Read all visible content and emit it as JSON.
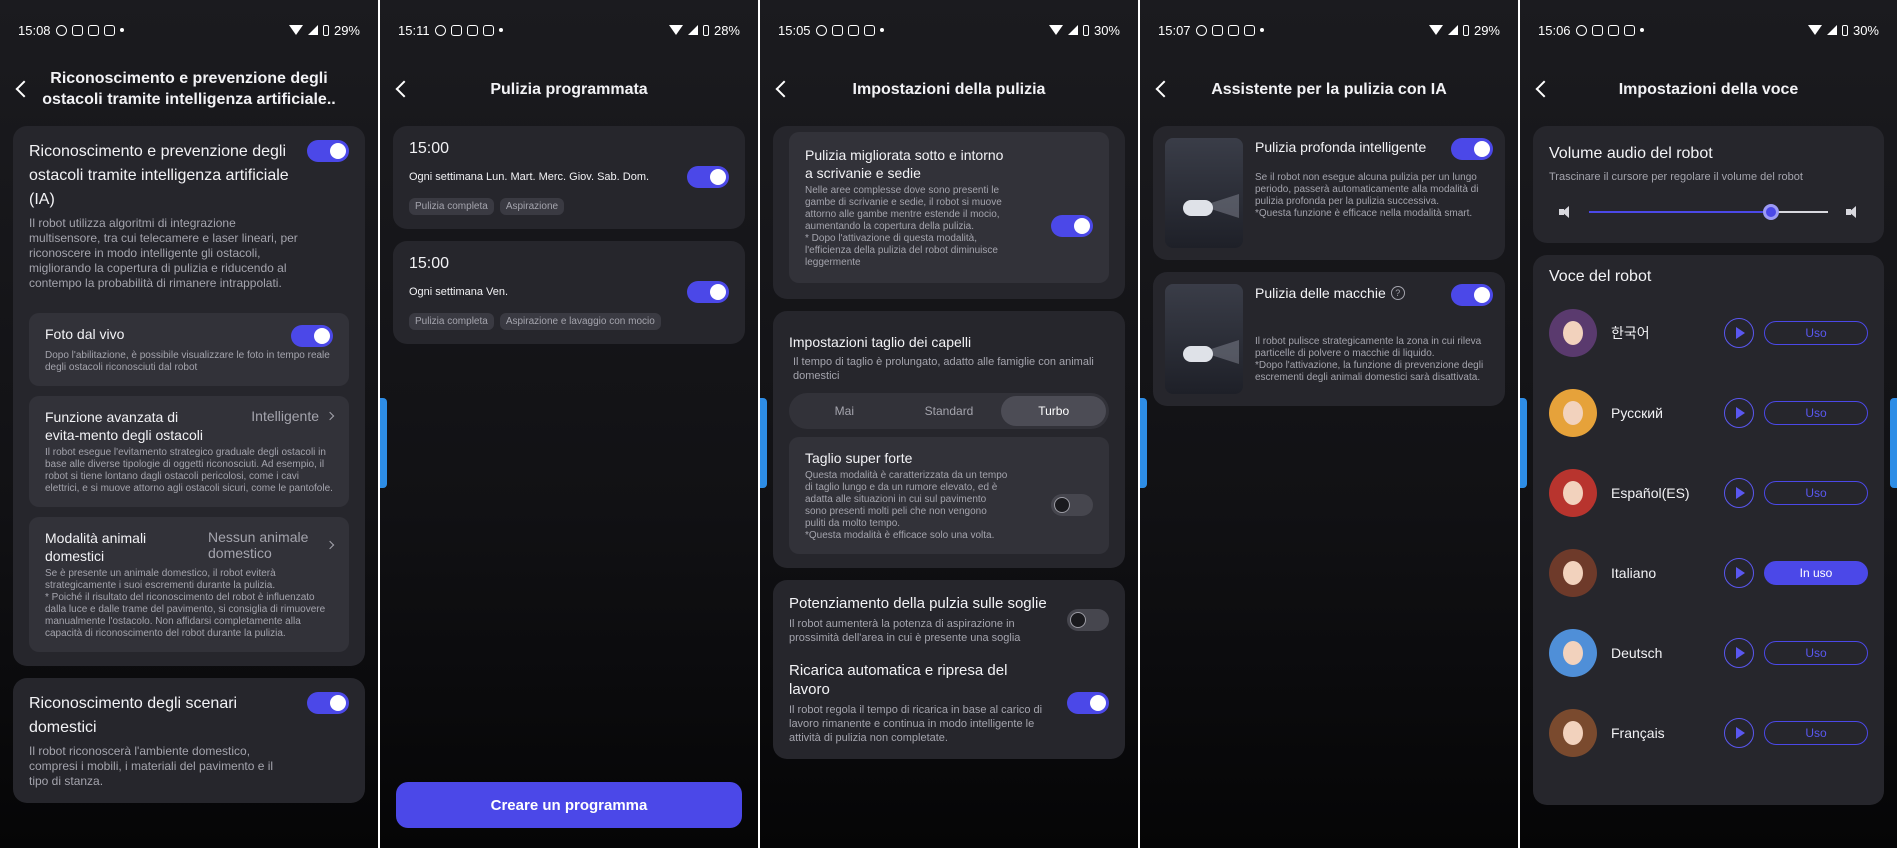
{
  "colors": {
    "accent": "#4b48e8",
    "background": "#1b1b1f",
    "card": "#26262c",
    "edge_tab": "#2d8de6"
  },
  "screens": [
    {
      "status": {
        "time": "15:08",
        "battery": "29%"
      },
      "title": "Riconoscimento e prevenzione degli ostacoli tramite intelligenza artificiale..",
      "main": {
        "title": "Riconoscimento e prevenzione degli ostacoli tramite intelligenza artificiale (IA)",
        "toggle_on": true,
        "desc": "Il robot utilizza algoritmi di integrazione multisensore, tra cui telecamere e laser lineari, per riconoscere in modo intelligente gli ostacoli, migliorando la copertura di pulizia e riducendo al contempo la probabilità di rimanere intrappolati.",
        "live_photo": {
          "title": "Foto dal vivo",
          "toggle_on": true,
          "desc": "Dopo l'abilitazione, è possibile visualizzare le foto in tempo reale degli ostacoli riconosciuti dal robot"
        },
        "advanced": {
          "title": "Funzione avanzata di evita-mento degli ostacoli",
          "value": "Intelligente",
          "desc": "Il robot esegue l'evitamento strategico graduale degli ostacoli in base alle diverse tipologie di oggetti riconosciuti. Ad esempio, il robot si tiene lontano dagli ostacoli pericolosi, come i cavi elettrici, e si muove attorno agli ostacoli sicuri, come le pantofole."
        },
        "pets": {
          "title": "Modalità animali domestici",
          "value": "Nessun animale domestico",
          "desc": "Se è presente un animale domestico, il robot eviterà strategicamente i suoi escrementi durante la pulizia.\n* Poiché il risultato del riconoscimento del robot è influenzato dalla luce e dalle trame del pavimento, si consiglia di rimuovere manualmente l'ostacolo. Non affidarsi completamente alla capacità di riconoscimento del robot durante la pulizia."
        }
      },
      "scenes": {
        "title": "Riconoscimento degli scenari domestici",
        "toggle_on": true,
        "desc": "Il robot riconoscerà l'ambiente domestico, compresi i mobili, i materiali del pavimento e il tipo di stanza."
      }
    },
    {
      "status": {
        "time": "15:11",
        "battery": "28%"
      },
      "title": "Pulizia programmata",
      "schedules": [
        {
          "time": "15:00",
          "days": "Ogni settimana Lun. Mart. Merc. Giov. Sab. Dom.",
          "toggle_on": true,
          "chips": [
            "Pulizia completa",
            "Aspirazione"
          ]
        },
        {
          "time": "15:00",
          "days": "Ogni settimana Ven.",
          "toggle_on": true,
          "chips": [
            "Pulizia completa",
            "Aspirazione e lavaggio con mocio"
          ]
        }
      ],
      "cta": "Creare un programma"
    },
    {
      "status": {
        "time": "15:05",
        "battery": "30%"
      },
      "title": "Impostazioni della pulizia",
      "desks": {
        "title": "Pulizia migliorata sotto e intorno a scrivanie e sedie",
        "toggle_on": true,
        "desc": "Nelle aree complesse dove sono presenti le gambe di scrivanie e sedie, il robot si muove attorno alle gambe mentre estende il mocio, aumentando la copertura della pulizia.\n* Dopo l'attivazione di questa modalità, l'efficienza della pulizia del robot diminuisce leggermente"
      },
      "hair": {
        "title": "Impostazioni taglio dei capelli",
        "desc": "Il tempo di taglio è prolungato, adatto alle famiglie con animali domestici",
        "options": [
          "Mai",
          "Standard",
          "Turbo"
        ],
        "selected": "Turbo",
        "super": {
          "title": "Taglio super forte",
          "toggle_on": false,
          "desc": "Questa modalità è caratterizzata da un tempo di taglio lungo e da un rumore elevato, ed è adatta alle situazioni in cui sul pavimento sono presenti molti peli che non vengono puliti da molto tempo.\n*Questa modalità è efficace solo una volta."
        }
      },
      "thresholds": {
        "title": "Potenziamento della pulzia sulle soglie",
        "toggle_on": false,
        "desc": "Il robot aumenterà la potenza di aspirazione in prossimità dell'area in cui è presente una soglia"
      },
      "recharge": {
        "title": "Ricarica automatica e ripresa del lavoro",
        "toggle_on": true,
        "desc": "Il robot regola il tempo di ricarica in base al carico di lavoro rimanente e continua in modo intelligente le attività di pulizia non completate."
      }
    },
    {
      "status": {
        "time": "15:07",
        "battery": "29%"
      },
      "title": "Assistente per la pulizia con IA",
      "deep": {
        "title": "Pulizia profonda intelligente",
        "toggle_on": true,
        "desc": "Se il robot non esegue alcuna pulizia per un lungo periodo, passerà automaticamente alla modalità di pulizia profonda per la pulizia successiva.\n*Questa funzione è efficace nella modalità smart."
      },
      "stains": {
        "title": "Pulizia delle macchie",
        "toggle_on": true,
        "help": "?",
        "desc": "Il robot pulisce strategicamente la zona in cui rileva particelle di polvere o macchie di liquido.\n*Dopo l'attivazione, la funzione di prevenzione degli escrementi degli animali domestici sarà disattivata."
      }
    },
    {
      "status": {
        "time": "15:06",
        "battery": "30%"
      },
      "title": "Impostazioni della voce",
      "volume": {
        "title": "Volume audio del robot",
        "desc": "Trascinare il cursore per regolare il volume del robot",
        "level": 0.76
      },
      "voices_title": "Voce del robot",
      "voices": [
        {
          "name": "한국어",
          "button": "Uso",
          "active": false,
          "hair": "#5a3a6e"
        },
        {
          "name": "Русский",
          "button": "Uso",
          "active": false,
          "hair": "#e6a23a"
        },
        {
          "name": "Español(ES)",
          "button": "Uso",
          "active": false,
          "hair": "#b8342e"
        },
        {
          "name": "Italiano",
          "button": "In uso",
          "active": true,
          "hair": "#6e3a2a"
        },
        {
          "name": "Deutsch",
          "button": "Uso",
          "active": false,
          "hair": "#4f8fd8"
        },
        {
          "name": "Français",
          "button": "Uso",
          "active": false,
          "hair": "#7a4a2e"
        }
      ]
    }
  ]
}
